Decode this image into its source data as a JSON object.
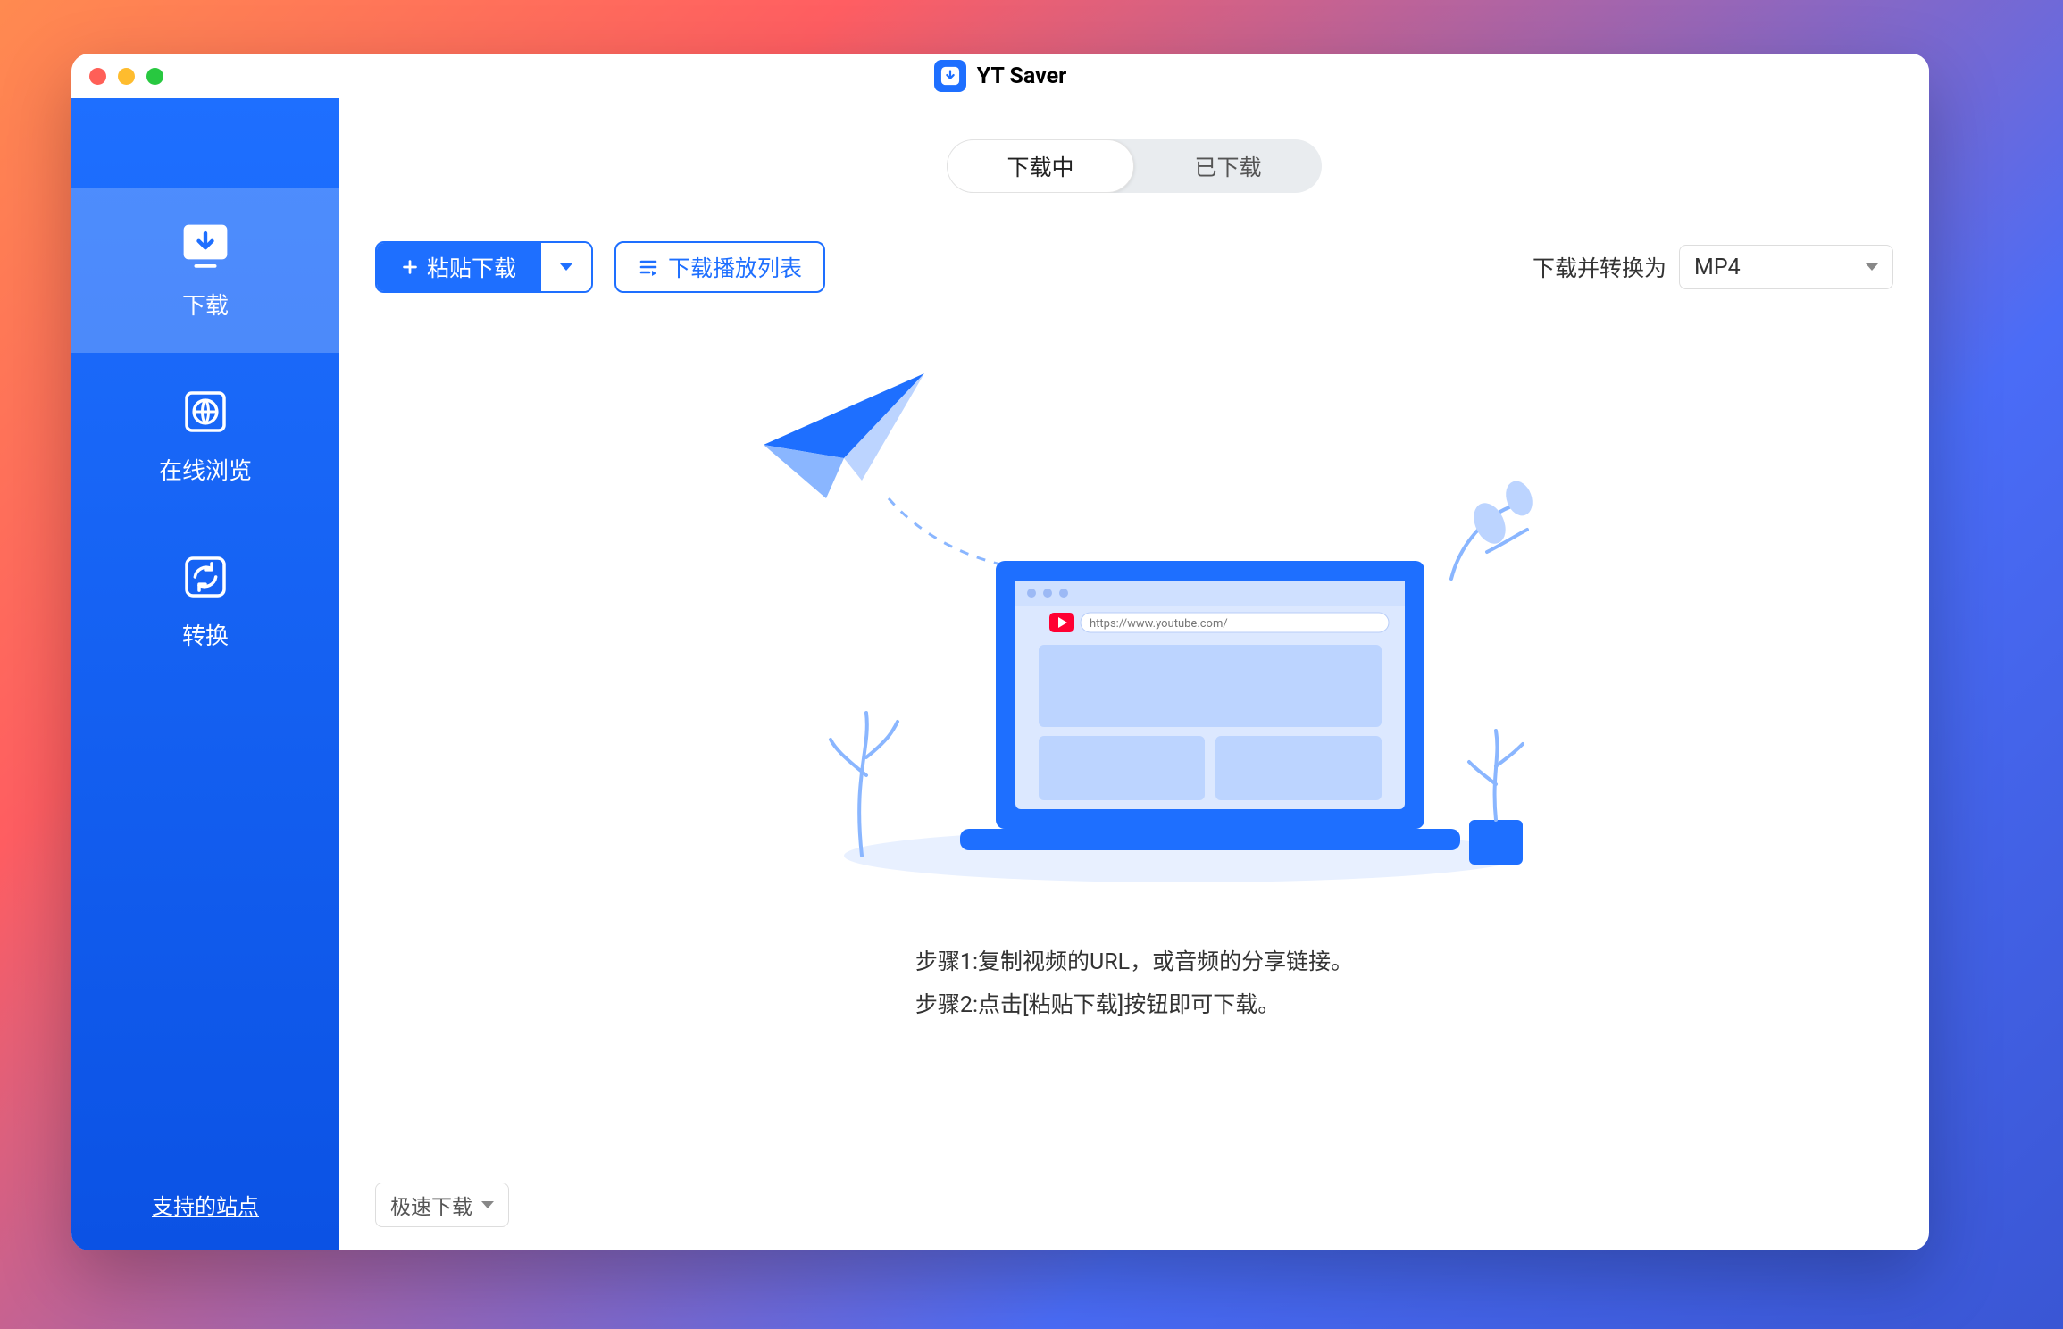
{
  "header": {
    "title": "YT Saver"
  },
  "sidebar": {
    "items": [
      {
        "label": "下载"
      },
      {
        "label": "在线浏览"
      },
      {
        "label": "转换"
      }
    ],
    "footer": "支持的站点"
  },
  "tabs": {
    "downloading": "下载中",
    "downloaded": "已下载"
  },
  "toolbar": {
    "paste_label": "粘贴下载",
    "playlist_label": "下载播放列表",
    "convert_prefix": "下载并转换为",
    "format_selected": "MP4"
  },
  "illustration": {
    "browser_url": "https://www.youtube.com/"
  },
  "steps": {
    "step1": "步骤1:复制视频的URL，或音频的分享链接。",
    "step2": "步骤2:点击[粘贴下载]按钮即可下载。"
  },
  "bottom": {
    "speed_label": "极速下载"
  }
}
